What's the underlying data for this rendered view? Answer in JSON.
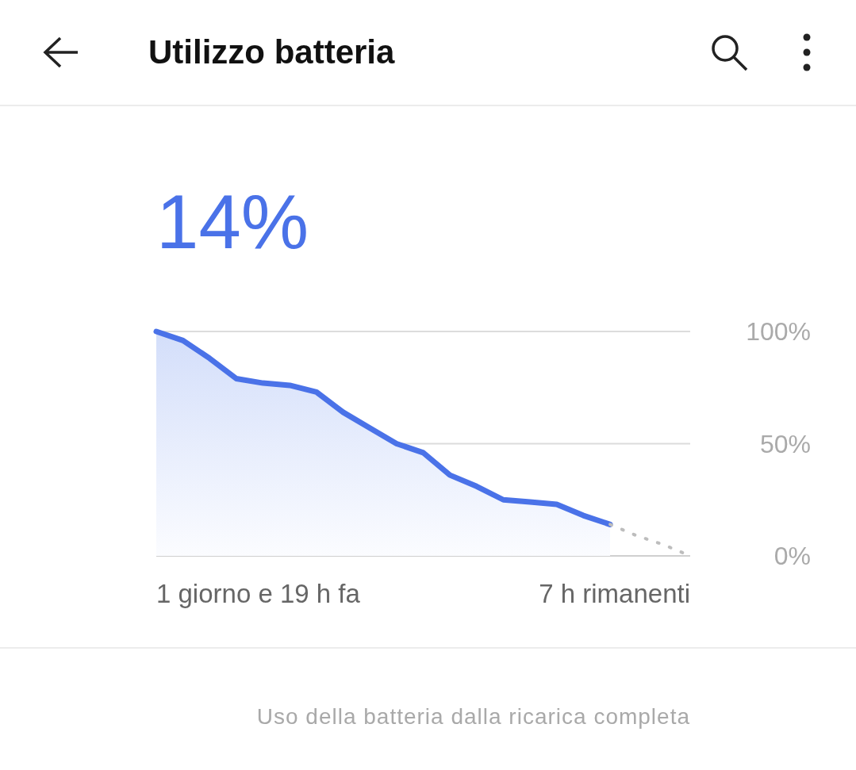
{
  "header": {
    "title": "Utilizzo batteria"
  },
  "battery": {
    "percent": "14%"
  },
  "chart_data": {
    "type": "area",
    "ylim": [
      0,
      100
    ],
    "yticks": [
      {
        "value": 100,
        "label": "100%"
      },
      {
        "value": 50,
        "label": "50%"
      },
      {
        "value": 0,
        "label": "0%"
      }
    ],
    "series": [
      {
        "color": "#4a72e8",
        "values": [
          100,
          96,
          88,
          79,
          77,
          76,
          73,
          64,
          57,
          50,
          46,
          36,
          31,
          25,
          24,
          23,
          18,
          14,
          null,
          null,
          null
        ]
      },
      {
        "type": "line",
        "color": "#bdbdbd",
        "line_style": "dotted",
        "values": [
          null,
          null,
          null,
          null,
          null,
          null,
          null,
          null,
          null,
          null,
          null,
          null,
          null,
          null,
          null,
          null,
          null,
          14,
          9,
          5,
          0
        ]
      }
    ]
  },
  "x_labels": [
    "1 giorno e 19 h fa",
    "7 h rimanenti"
  ],
  "footer": {
    "caption": "Uso della batteria dalla ricarica completa"
  }
}
